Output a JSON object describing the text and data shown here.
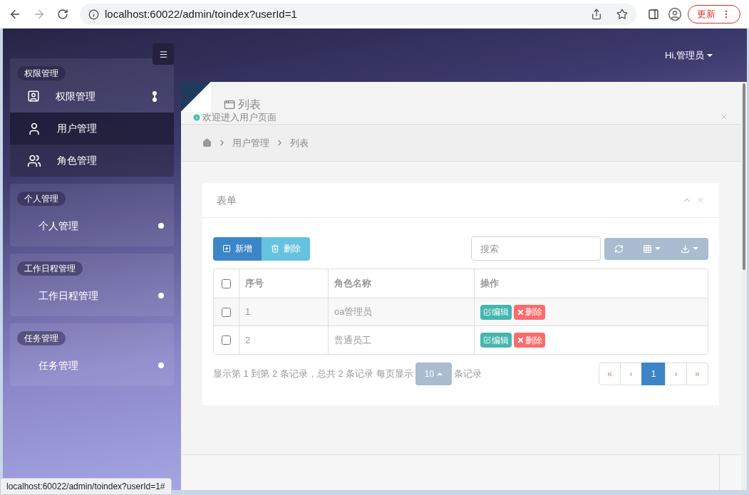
{
  "browser": {
    "url": "localhost:60022/admin/toindex?userId=1",
    "update_button": "更新"
  },
  "header": {
    "user": "Hi,管理员"
  },
  "sidebar": {
    "groups": [
      {
        "title": "权限管理",
        "menu": {
          "label": "权限管理",
          "expanded": true,
          "children": [
            {
              "label": "用户管理",
              "selected": true
            },
            {
              "label": "角色管理",
              "selected": false
            }
          ]
        }
      },
      {
        "title": "个人管理",
        "menu": {
          "label": "个人管理",
          "expanded": false
        }
      },
      {
        "title": "工作日程管理",
        "menu": {
          "label": "工作日程管理",
          "expanded": false
        }
      },
      {
        "title": "任务管理",
        "menu": {
          "label": "任务管理",
          "expanded": false
        }
      }
    ]
  },
  "tab": {
    "label": "列表"
  },
  "notice": {
    "text": "欢迎进入用户页面"
  },
  "breadcrumb": [
    "用户管理",
    "列表"
  ],
  "card": {
    "title": "表单",
    "toolbar": {
      "add": "新增",
      "delete": "删除",
      "search_placeholder": "搜索"
    },
    "table": {
      "header_checked": false,
      "columns": [
        "序号",
        "角色名称",
        "操作"
      ],
      "rows": [
        {
          "checked": false,
          "cells": [
            "1",
            "oa管理员"
          ],
          "actions": [
            "编辑",
            "删除"
          ]
        },
        {
          "checked": false,
          "cells": [
            "2",
            "普通员工"
          ],
          "actions": [
            "编辑",
            "删除"
          ]
        }
      ]
    },
    "pagination": {
      "info": "显示第 1 到第 2 条记录，总共 2 条记录 每页显示",
      "page_size": "10",
      "suffix": "条记录",
      "pages": [
        {
          "label": "«",
          "selected": false
        },
        {
          "label": "‹",
          "selected": false
        },
        {
          "label": "1",
          "selected": true
        },
        {
          "label": "›",
          "selected": false
        },
        {
          "label": "»",
          "selected": false
        }
      ]
    }
  },
  "status_bar": {
    "url": "localhost:60022/admin/toindex?userId=1#"
  }
}
